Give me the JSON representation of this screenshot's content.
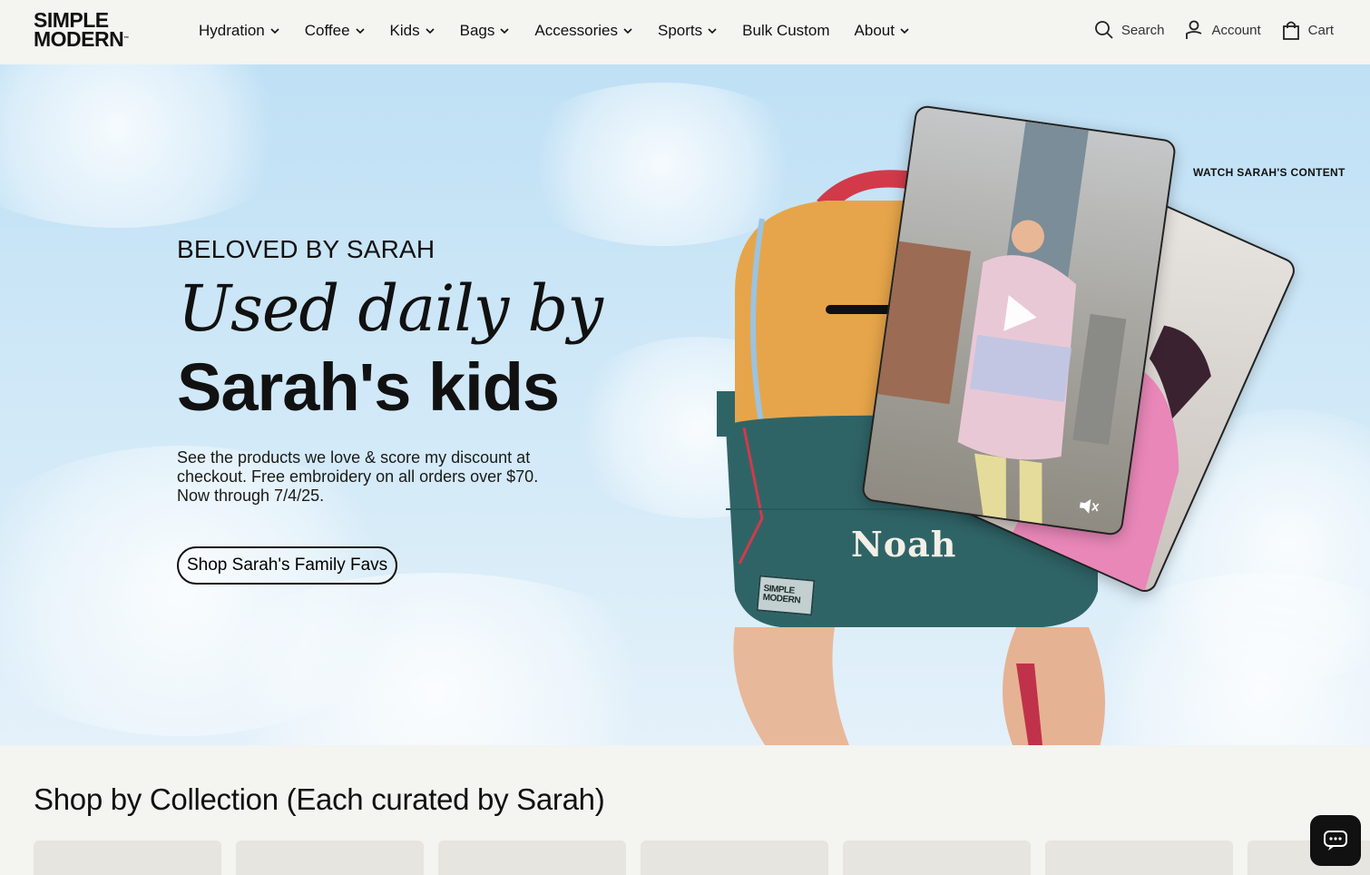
{
  "brand": {
    "line1": "SIMPLE",
    "line2": "MODERN",
    "tm": "™"
  },
  "nav": [
    {
      "label": "Hydration",
      "has_dropdown": true
    },
    {
      "label": "Coffee",
      "has_dropdown": true
    },
    {
      "label": "Kids",
      "has_dropdown": true
    },
    {
      "label": "Bags",
      "has_dropdown": true
    },
    {
      "label": "Accessories",
      "has_dropdown": true
    },
    {
      "label": "Sports",
      "has_dropdown": true
    },
    {
      "label": "Bulk Custom",
      "has_dropdown": false
    },
    {
      "label": "About",
      "has_dropdown": true
    }
  ],
  "utils": {
    "search": "Search",
    "account": "Account",
    "cart": "Cart"
  },
  "hero": {
    "eyebrow": "BELOVED BY SARAH",
    "headline_italic": "Used daily by",
    "headline_bold": "Sarah's kids",
    "description": "See the products we love & score my discount at checkout. Free embroidery on all orders over $70. Now through 7/4/25.",
    "cta": "Shop Sarah's Family Favs",
    "watch_link": "WATCH SARAH'S CONTENT",
    "bag_name": "Noah",
    "patch_line1": "SIMPLE",
    "patch_line2": "MODERN"
  },
  "collection": {
    "title": "Shop by Collection (Each curated by Sarah)",
    "tile_count": 7
  },
  "icons": [
    "chevron-down-icon",
    "search-icon",
    "account-icon",
    "cart-icon",
    "play-icon",
    "mute-icon",
    "chat-icon"
  ],
  "colors": {
    "background": "#f4f4f0",
    "sky": "#c8e4f6",
    "ink": "#111111",
    "bag_orange": "#e6a54a",
    "bag_teal": "#2f6467",
    "tile": "#e6e5df"
  }
}
